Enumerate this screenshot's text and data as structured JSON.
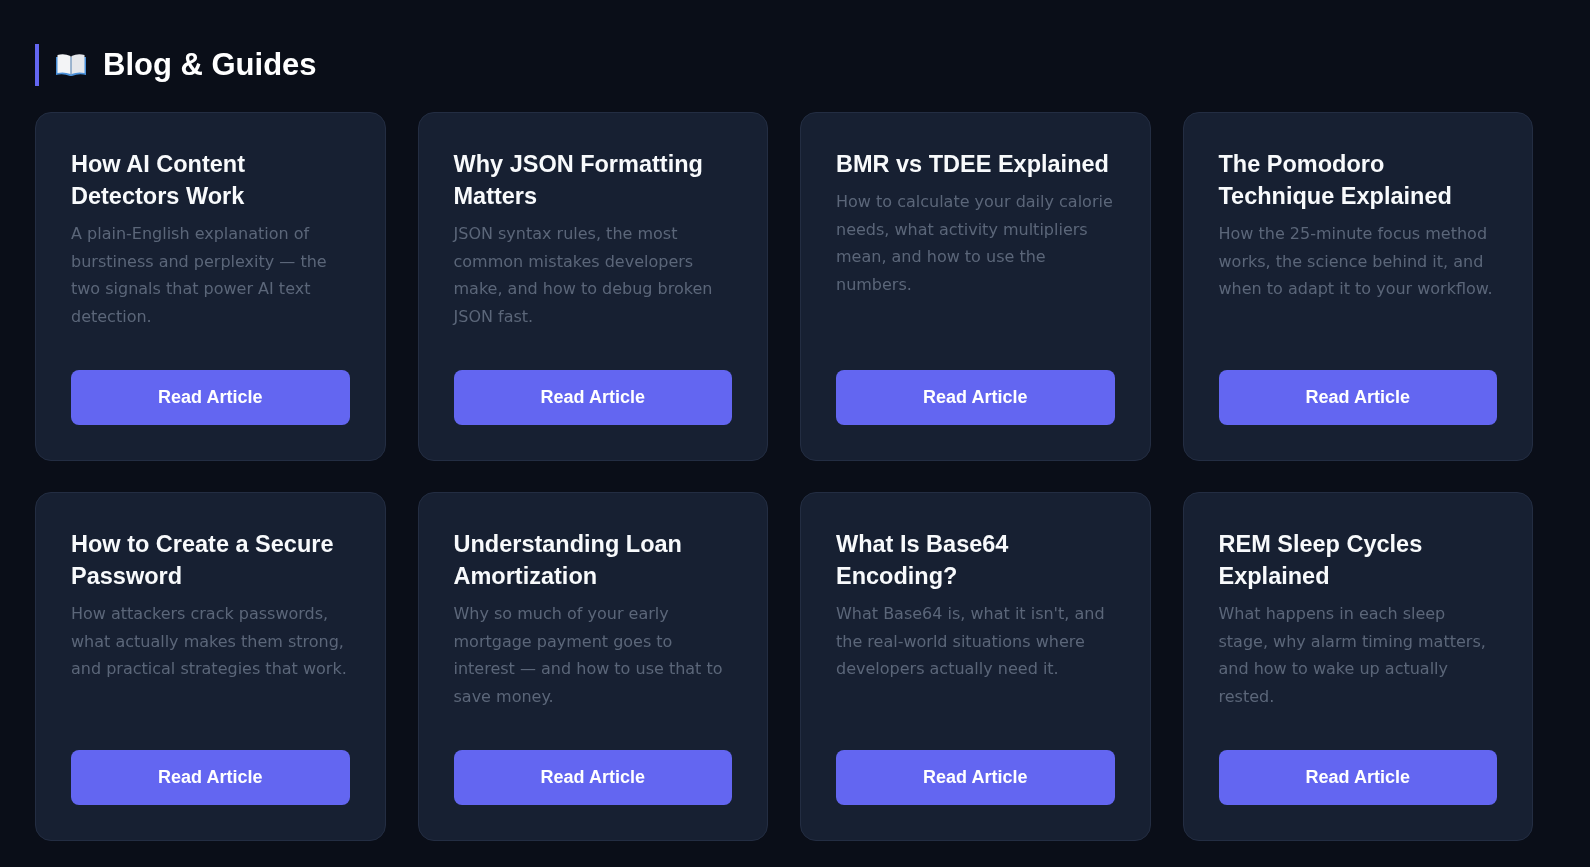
{
  "heading": {
    "title": "Blog & Guides"
  },
  "articles": [
    {
      "title": "How AI Content Detectors Work",
      "description": "A plain-English explanation of burstiness and perplexity — the two signals that power AI text detection.",
      "button": "Read Article"
    },
    {
      "title": "Why JSON Formatting Matters",
      "description": "JSON syntax rules, the most common mistakes developers make, and how to debug broken JSON fast.",
      "button": "Read Article"
    },
    {
      "title": "BMR vs TDEE Explained",
      "description": "How to calculate your daily calorie needs, what activity multipliers mean, and how to use the numbers.",
      "button": "Read Article"
    },
    {
      "title": "The Pomodoro Technique Explained",
      "description": "How the 25-minute focus method works, the science behind it, and when to adapt it to your workflow.",
      "button": "Read Article"
    },
    {
      "title": "How to Create a Secure Password",
      "description": "How attackers crack passwords, what actually makes them strong, and practical strategies that work.",
      "button": "Read Article"
    },
    {
      "title": "Understanding Loan Amortization",
      "description": "Why so much of your early mortgage payment goes to interest — and how to use that to save money.",
      "button": "Read Article"
    },
    {
      "title": "What Is Base64 Encoding?",
      "description": "What Base64 is, what it isn't, and the real-world situations where developers actually need it.",
      "button": "Read Article"
    },
    {
      "title": "REM Sleep Cycles Explained",
      "description": "What happens in each sleep stage, why alarm timing matters, and how to wake up actually rested.",
      "button": "Read Article"
    }
  ]
}
